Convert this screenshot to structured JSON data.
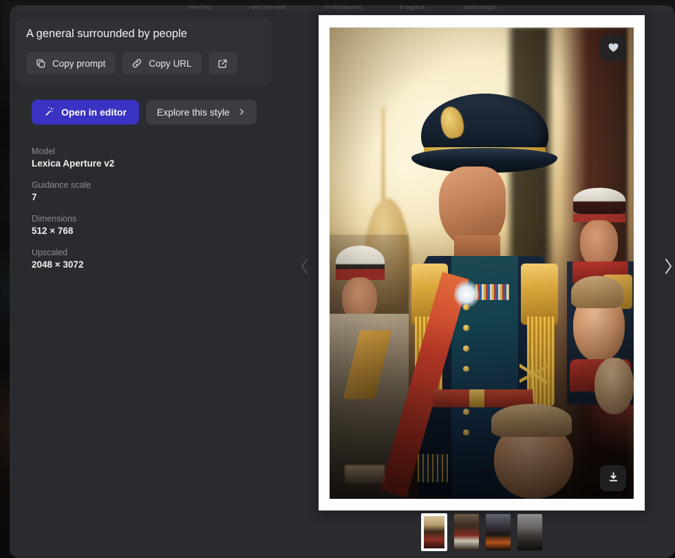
{
  "topnav": {
    "items": [
      "Home",
      "Generate",
      "Premium",
      "Pages",
      "Settings"
    ]
  },
  "prompt": {
    "text": "A general surrounded by people",
    "copy_prompt_label": "Copy prompt",
    "copy_url_label": "Copy URL",
    "open_external_label": ""
  },
  "actions": {
    "open_in_editor_label": "Open in editor",
    "explore_style_label": "Explore this style",
    "explore_chevron": "›",
    "primary_color": "#3a32c2"
  },
  "meta": [
    {
      "label": "Model",
      "value": "Lexica Aperture v2"
    },
    {
      "label": "Guidance scale",
      "value": "7"
    },
    {
      "label": "Dimensions",
      "value": "512 × 768"
    },
    {
      "label": "Upscaled",
      "value": "2048 × 3072"
    }
  ],
  "viewer": {
    "prev_icon": "chevron-left-icon",
    "next_icon": "chevron-right-icon",
    "like_icon": "heart-icon",
    "download_icon": "download-icon",
    "image_alt": "A general surrounded by people"
  },
  "thumbnails": [
    {
      "name": "variation-1",
      "selected": true
    },
    {
      "name": "variation-2",
      "selected": false
    },
    {
      "name": "variation-3",
      "selected": false
    },
    {
      "name": "variation-4",
      "selected": false
    }
  ]
}
